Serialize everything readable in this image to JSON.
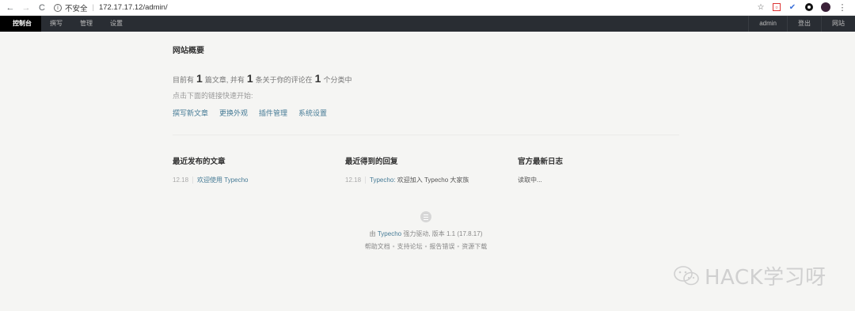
{
  "browser": {
    "security_label": "不安全",
    "url": "172.17.17.12/admin/"
  },
  "topbar": {
    "nav": [
      "控制台",
      "撰写",
      "管理",
      "设置"
    ],
    "right": [
      "admin",
      "登出",
      "网站"
    ]
  },
  "overview": {
    "title": "网站概要",
    "stats_prefix": "目前有",
    "posts_count": "1",
    "stats_mid1": "篇文章, 并有",
    "comments_count": "1",
    "stats_mid2": "条关于你的评论在",
    "categories_count": "1",
    "stats_suffix": "个分类中",
    "hint": "点击下面的链接快速开始:",
    "quick_links": [
      "撰写新文章",
      "更换外观",
      "插件管理",
      "系统设置"
    ]
  },
  "recent_posts": {
    "title": "最近发布的文章",
    "items": [
      {
        "date": "12.18",
        "title": "欢迎使用 Typecho"
      }
    ]
  },
  "recent_comments": {
    "title": "最近得到的回复",
    "items": [
      {
        "date": "12.18",
        "author": "Typecho:",
        "text": "欢迎加入 Typecho 大家族"
      }
    ]
  },
  "official_log": {
    "title": "官方最新日志",
    "loading": "读取中..."
  },
  "footer": {
    "powered_prefix": "由",
    "powered_link": "Typecho",
    "powered_suffix": "强力驱动, 版本 1.1 (17.8.17)",
    "links": [
      "帮助文档",
      "支持论坛",
      "报告错误",
      "资源下载"
    ]
  },
  "watermark": {
    "text": "HACK学习呀"
  }
}
